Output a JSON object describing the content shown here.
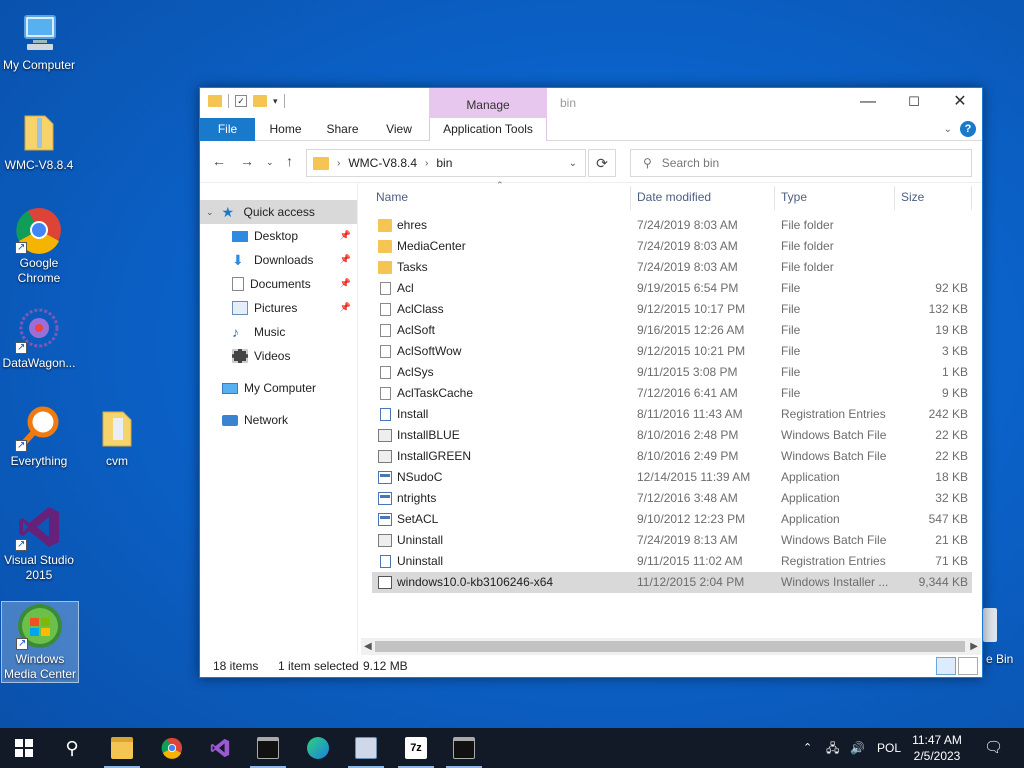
{
  "desktop": {
    "icons": [
      {
        "label": "My Computer"
      },
      {
        "label": "WMC-V8.8.4"
      },
      {
        "label": "Google Chrome"
      },
      {
        "label": "DataWagon..."
      },
      {
        "label": "Everything"
      },
      {
        "label": "cvm"
      },
      {
        "label": "Visual Studio 2015"
      },
      {
        "label": "Windows Media Center"
      }
    ],
    "recycle_bin_partial": "e Bin"
  },
  "window": {
    "title": "bin",
    "manage_tab": "Manage",
    "controls": {
      "minimize": "—",
      "maximize": "☐",
      "close": "✕"
    },
    "ribbon_tabs": [
      "File",
      "Home",
      "Share",
      "View",
      "Application Tools"
    ],
    "address": {
      "crumbs": [
        "WMC-V8.8.4",
        "bin"
      ]
    },
    "search_placeholder": "Search bin",
    "nav": {
      "quick_access": "Quick access",
      "items": [
        "Desktop",
        "Downloads",
        "Documents",
        "Pictures",
        "Music",
        "Videos"
      ],
      "my_computer": "My Computer",
      "network": "Network"
    },
    "columns": [
      "Name",
      "Date modified",
      "Type",
      "Size"
    ],
    "files": [
      {
        "name": "ehres",
        "date": "7/24/2019 8:03 AM",
        "type": "File folder",
        "size": "",
        "icon": "folder"
      },
      {
        "name": "MediaCenter",
        "date": "7/24/2019 8:03 AM",
        "type": "File folder",
        "size": "",
        "icon": "folder"
      },
      {
        "name": "Tasks",
        "date": "7/24/2019 8:03 AM",
        "type": "File folder",
        "size": "",
        "icon": "folder"
      },
      {
        "name": "Acl",
        "date": "9/19/2015 6:54 PM",
        "type": "File",
        "size": "92 KB",
        "icon": "doc"
      },
      {
        "name": "AclClass",
        "date": "9/12/2015 10:17 PM",
        "type": "File",
        "size": "132 KB",
        "icon": "doc"
      },
      {
        "name": "AclSoft",
        "date": "9/16/2015 12:26 AM",
        "type": "File",
        "size": "19 KB",
        "icon": "doc"
      },
      {
        "name": "AclSoftWow",
        "date": "9/12/2015 10:21 PM",
        "type": "File",
        "size": "3 KB",
        "icon": "doc"
      },
      {
        "name": "AclSys",
        "date": "9/11/2015 3:08 PM",
        "type": "File",
        "size": "1 KB",
        "icon": "doc"
      },
      {
        "name": "AclTaskCache",
        "date": "7/12/2016 6:41 AM",
        "type": "File",
        "size": "9 KB",
        "icon": "doc"
      },
      {
        "name": "Install",
        "date": "8/11/2016 11:43 AM",
        "type": "Registration Entries",
        "size": "242 KB",
        "icon": "reg"
      },
      {
        "name": "InstallBLUE",
        "date": "8/10/2016 2:48 PM",
        "type": "Windows Batch File",
        "size": "22 KB",
        "icon": "bat"
      },
      {
        "name": "InstallGREEN",
        "date": "8/10/2016 2:49 PM",
        "type": "Windows Batch File",
        "size": "22 KB",
        "icon": "bat"
      },
      {
        "name": "NSudoC",
        "date": "12/14/2015 11:39 AM",
        "type": "Application",
        "size": "18 KB",
        "icon": "app"
      },
      {
        "name": "ntrights",
        "date": "7/12/2016 3:48 AM",
        "type": "Application",
        "size": "32 KB",
        "icon": "app"
      },
      {
        "name": "SetACL",
        "date": "9/10/2012 12:23 PM",
        "type": "Application",
        "size": "547 KB",
        "icon": "app"
      },
      {
        "name": "Uninstall",
        "date": "7/24/2019 8:13 AM",
        "type": "Windows Batch File",
        "size": "21 KB",
        "icon": "bat"
      },
      {
        "name": "Uninstall",
        "date": "9/11/2015 11:02 AM",
        "type": "Registration Entries",
        "size": "71 KB",
        "icon": "reg"
      },
      {
        "name": "windows10.0-kb3106246-x64",
        "date": "11/12/2015 2:04 PM",
        "type": "Windows Installer ...",
        "size": "9,344 KB",
        "icon": "msi",
        "selected": true
      }
    ],
    "status": {
      "items": "18 items",
      "selected": "1 item selected",
      "size": "9.12 MB"
    }
  },
  "taskbar": {
    "language": "POL",
    "time": "11:47 AM",
    "date": "2/5/2023"
  },
  "colors": {
    "accent": "#1979ca",
    "manage": "#e8c7ee",
    "taskbar": "#111a26"
  }
}
